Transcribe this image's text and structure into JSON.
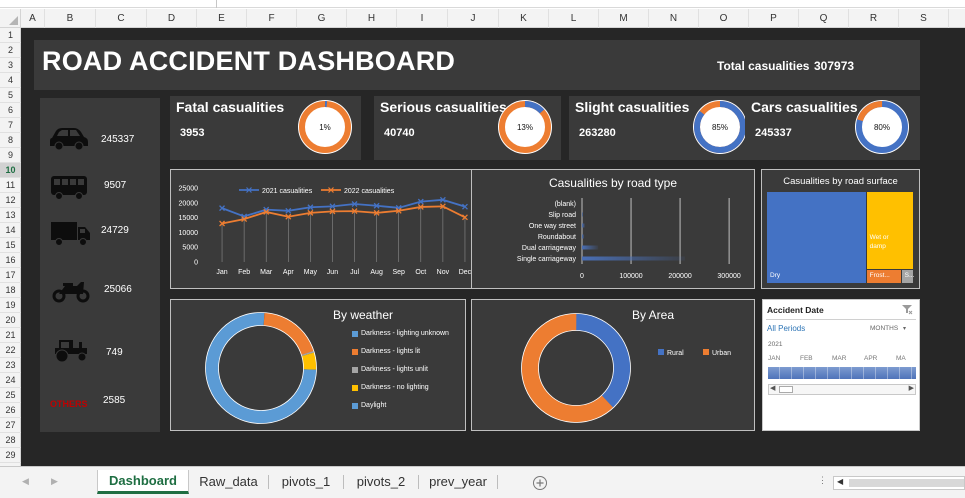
{
  "sheet": {
    "columns": [
      "A",
      "B",
      "C",
      "D",
      "E",
      "F",
      "G",
      "H",
      "I",
      "J",
      "K",
      "L",
      "M",
      "N",
      "O",
      "P",
      "Q",
      "R",
      "S"
    ],
    "rows": [
      "1",
      "2",
      "3",
      "4",
      "5",
      "6",
      "7",
      "8",
      "9",
      "10",
      "11",
      "12",
      "13",
      "14",
      "15",
      "16",
      "17",
      "18",
      "19",
      "20",
      "21",
      "22",
      "23",
      "24",
      "25",
      "26",
      "27",
      "28",
      "29"
    ],
    "selected_row": "10",
    "tabs": [
      "Dashboard",
      "Raw_data",
      "pivots_1",
      "pivots_2",
      "prev_year"
    ],
    "active_tab": "Dashboard",
    "add_sheet_icon": "plus-circle-icon"
  },
  "header": {
    "title": "ROAD ACCIDENT DASHBOARD",
    "total_label": "Total casualities",
    "total_value": "307973"
  },
  "vehicles": [
    {
      "icon": "car-icon",
      "value": "245337"
    },
    {
      "icon": "bus-icon",
      "value": "9507"
    },
    {
      "icon": "truck-icon",
      "value": "24729"
    },
    {
      "icon": "motorcycle-icon",
      "value": "25066"
    },
    {
      "icon": "tractor-icon",
      "value": "749"
    },
    {
      "icon": "others-label",
      "label": "OTHERS",
      "value": "2585"
    }
  ],
  "kpis": [
    {
      "title": "Fatal casualities",
      "value": "3953",
      "pct_label": "1%",
      "pct": 1.3
    },
    {
      "title": "Serious casualities",
      "value": "40740",
      "pct_label": "13%",
      "pct": 13.2
    },
    {
      "title": "Slight casualities",
      "value": "263280",
      "pct_label": "85%",
      "pct": 85.5
    },
    {
      "title": "Cars casualities",
      "value": "245337",
      "pct_label": "80%",
      "pct": 79.7
    }
  ],
  "colors": {
    "orange": "#ed7d31",
    "blue": "#4472c4",
    "light_blue": "#5b9bd5",
    "yellow": "#ffc000",
    "grey": "#a5a5a5",
    "panel": "#3a3a3a",
    "background": "#262626"
  },
  "chart_data": [
    {
      "type": "line",
      "title": "",
      "categories": [
        "Jan",
        "Feb",
        "Mar",
        "Apr",
        "May",
        "Jun",
        "Jul",
        "Aug",
        "Sep",
        "Oct",
        "Nov",
        "Dec"
      ],
      "series": [
        {
          "name": "2021 casualities",
          "values": [
            18200,
            15400,
            17700,
            17300,
            18500,
            18800,
            19600,
            19000,
            18300,
            20400,
            21000,
            18700
          ]
        },
        {
          "name": "2022 casualities",
          "values": [
            13000,
            14500,
            16900,
            15300,
            16600,
            17100,
            17200,
            16600,
            17300,
            18600,
            18800,
            15100
          ]
        }
      ],
      "yticks": [
        "25000",
        "20000",
        "15000",
        "10000",
        "5000",
        "0"
      ],
      "ylim": [
        0,
        25000
      ]
    },
    {
      "type": "bar",
      "title": "Casualities by road type",
      "categories": [
        "(blank)",
        "Slip road",
        "One way street",
        "Roundabout",
        "Dual carriageway",
        "Single carriageway"
      ],
      "values": [
        0,
        2000,
        6000,
        4500,
        33000,
        210000
      ],
      "xticks": [
        "0",
        "100000",
        "200000",
        "300000"
      ],
      "xlim": [
        0,
        310000
      ]
    },
    {
      "type": "treemap",
      "title": "Casualities by road surface",
      "items": [
        {
          "name": "Dry",
          "value": 208000
        },
        {
          "name": "Wet or damp",
          "value": 85000
        },
        {
          "name": "Frost...",
          "value": 11000
        },
        {
          "name": "S...",
          "value": 4000
        }
      ]
    },
    {
      "type": "pie",
      "title": "By weather",
      "labels": [
        "Darkness - lighting unknown",
        "Darkness - lights lit",
        "Darkness - lights unlit",
        "Darkness - no lighting",
        "Daylight"
      ],
      "values": [
        1,
        19,
        0.5,
        5,
        74.5
      ]
    },
    {
      "type": "pie",
      "title": "By Area",
      "labels": [
        "Rural",
        "Urban"
      ],
      "values": [
        38,
        62
      ]
    }
  ],
  "slicer": {
    "title": "Accident  Date",
    "all_periods": "All Periods",
    "level": "MONTHS",
    "year": "2021",
    "months": [
      "JAN",
      "FEB",
      "MAR",
      "APR",
      "MA"
    ],
    "filter_icon": "filter-clear-icon"
  }
}
